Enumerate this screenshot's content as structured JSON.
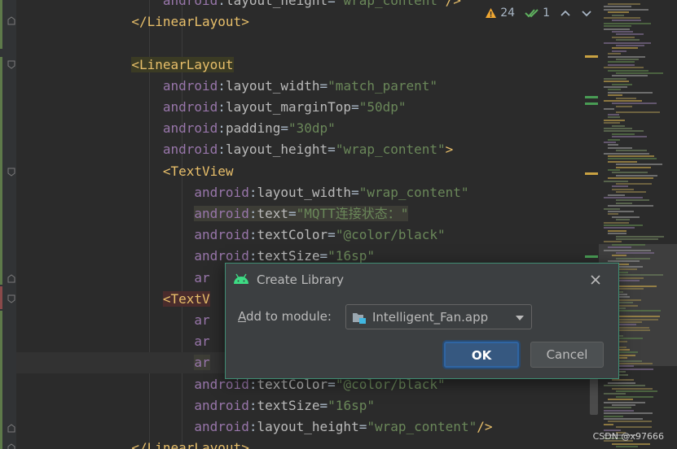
{
  "inspection": {
    "warnings_count": "24",
    "weak_warnings_count": "1",
    "warning_icon": "warning-triangle-icon",
    "weak_warning_icon": "double-check-icon",
    "prev_icon": "chevron-up-icon",
    "next_icon": "chevron-down-icon"
  },
  "code_lines": [
    {
      "indent": "        ",
      "tokens": [
        {
          "t": "android",
          "c": "ns"
        },
        {
          "t": ":",
          "c": "plain"
        },
        {
          "t": "layout_height",
          "c": "attr"
        },
        {
          "t": "=",
          "c": "plain"
        },
        {
          "t": "\"wrap_content\"",
          "c": "val"
        },
        {
          "t": "/>",
          "c": "tag"
        }
      ]
    },
    {
      "indent": "    ",
      "tokens": [
        {
          "t": "</LinearLayout>",
          "c": "tag"
        }
      ]
    },
    {
      "indent": "",
      "tokens": []
    },
    {
      "indent": "    ",
      "tokens": [
        {
          "t": "<LinearLayout",
          "c": "tag",
          "hl": "hl-tag"
        }
      ]
    },
    {
      "indent": "        ",
      "tokens": [
        {
          "t": "android",
          "c": "ns"
        },
        {
          "t": ":",
          "c": "plain"
        },
        {
          "t": "layout_width",
          "c": "attr"
        },
        {
          "t": "=",
          "c": "plain"
        },
        {
          "t": "\"match_parent\"",
          "c": "val"
        }
      ]
    },
    {
      "indent": "        ",
      "tokens": [
        {
          "t": "android",
          "c": "ns"
        },
        {
          "t": ":",
          "c": "plain"
        },
        {
          "t": "layout_marginTop",
          "c": "attr"
        },
        {
          "t": "=",
          "c": "plain"
        },
        {
          "t": "\"50dp\"",
          "c": "val"
        }
      ]
    },
    {
      "indent": "        ",
      "tokens": [
        {
          "t": "android",
          "c": "ns"
        },
        {
          "t": ":",
          "c": "plain"
        },
        {
          "t": "padding",
          "c": "attr"
        },
        {
          "t": "=",
          "c": "plain"
        },
        {
          "t": "\"30dp\"",
          "c": "val"
        }
      ]
    },
    {
      "indent": "        ",
      "tokens": [
        {
          "t": "android",
          "c": "ns"
        },
        {
          "t": ":",
          "c": "plain"
        },
        {
          "t": "layout_height",
          "c": "attr"
        },
        {
          "t": "=",
          "c": "plain"
        },
        {
          "t": "\"wrap_content\"",
          "c": "val"
        },
        {
          "t": ">",
          "c": "tag"
        }
      ]
    },
    {
      "indent": "        ",
      "tokens": [
        {
          "t": "<TextView",
          "c": "tag"
        }
      ]
    },
    {
      "indent": "            ",
      "tokens": [
        {
          "t": "android",
          "c": "ns"
        },
        {
          "t": ":",
          "c": "plain"
        },
        {
          "t": "layout_width",
          "c": "attr"
        },
        {
          "t": "=",
          "c": "plain"
        },
        {
          "t": "\"wrap_content\"",
          "c": "val"
        }
      ]
    },
    {
      "indent": "            ",
      "tokens": [
        {
          "t": "android",
          "c": "ns",
          "hl": "hl-attr"
        },
        {
          "t": ":",
          "c": "plain",
          "hl": "hl-attr"
        },
        {
          "t": "text",
          "c": "attr",
          "hl": "hl-attr"
        },
        {
          "t": "=",
          "c": "plain",
          "hl": "hl-attr"
        },
        {
          "t": "\"MQTT连接状态：\"",
          "c": "val",
          "hl": "hl-attr"
        }
      ]
    },
    {
      "indent": "            ",
      "tokens": [
        {
          "t": "android",
          "c": "ns"
        },
        {
          "t": ":",
          "c": "plain"
        },
        {
          "t": "textColor",
          "c": "attr"
        },
        {
          "t": "=",
          "c": "plain"
        },
        {
          "t": "\"@color/black\"",
          "c": "val"
        }
      ]
    },
    {
      "indent": "            ",
      "tokens": [
        {
          "t": "android",
          "c": "ns"
        },
        {
          "t": ":",
          "c": "plain"
        },
        {
          "t": "textSize",
          "c": "attr"
        },
        {
          "t": "=",
          "c": "plain"
        },
        {
          "t": "\"16sp\"",
          "c": "val"
        }
      ]
    },
    {
      "indent": "            ",
      "tokens": [
        {
          "t": "ar",
          "c": "ns"
        }
      ]
    },
    {
      "indent": "        ",
      "tokens": [
        {
          "t": "<TextV",
          "c": "tag",
          "hl": "hl-tag-red"
        }
      ]
    },
    {
      "indent": "            ",
      "tokens": [
        {
          "t": "ar",
          "c": "ns"
        }
      ]
    },
    {
      "indent": "            ",
      "tokens": [
        {
          "t": "ar",
          "c": "ns"
        }
      ]
    },
    {
      "indent": "            ",
      "tokens": [
        {
          "t": "ar",
          "c": "ns",
          "hl": "hl-attr"
        }
      ]
    },
    {
      "indent": "            ",
      "tokens": [
        {
          "t": "android",
          "c": "ns"
        },
        {
          "t": ":",
          "c": "plain"
        },
        {
          "t": "textColor",
          "c": "attr"
        },
        {
          "t": "=",
          "c": "plain"
        },
        {
          "t": "\"@color/black\"",
          "c": "val"
        }
      ]
    },
    {
      "indent": "            ",
      "tokens": [
        {
          "t": "android",
          "c": "ns"
        },
        {
          "t": ":",
          "c": "plain"
        },
        {
          "t": "textSize",
          "c": "attr"
        },
        {
          "t": "=",
          "c": "plain"
        },
        {
          "t": "\"16sp\"",
          "c": "val"
        }
      ]
    },
    {
      "indent": "            ",
      "tokens": [
        {
          "t": "android",
          "c": "ns"
        },
        {
          "t": ":",
          "c": "plain"
        },
        {
          "t": "layout_height",
          "c": "attr"
        },
        {
          "t": "=",
          "c": "plain"
        },
        {
          "t": "\"wrap_content\"",
          "c": "val"
        },
        {
          "t": "/>",
          "c": "tag"
        }
      ]
    },
    {
      "indent": "    ",
      "tokens": [
        {
          "t": "</LinearLayout>",
          "c": "tag"
        }
      ]
    }
  ],
  "dialog": {
    "title": "Create Library",
    "title_icon": "android-logo-icon",
    "close_icon": "close-icon",
    "module_label_mnemonic": "A",
    "module_label_rest": "dd to module:",
    "module_value": "Intelligent_Fan.app",
    "module_icon": "module-folder-icon",
    "dropdown_icon": "dropdown-arrow-icon",
    "ok_label": "OK",
    "cancel_label": "Cancel"
  },
  "watermark": "CSDN @x97666",
  "colors": {
    "background": "#2b2b2b",
    "tag": "#e8bf6a",
    "namespace": "#9876aa",
    "attribute": "#bababa",
    "value": "#6a8759",
    "dialog_bg": "#3c3f41",
    "dialog_border": "#3f8d73",
    "ok_button": "#365880",
    "warning": "#f0a732",
    "android_green": "#3ddc84"
  }
}
